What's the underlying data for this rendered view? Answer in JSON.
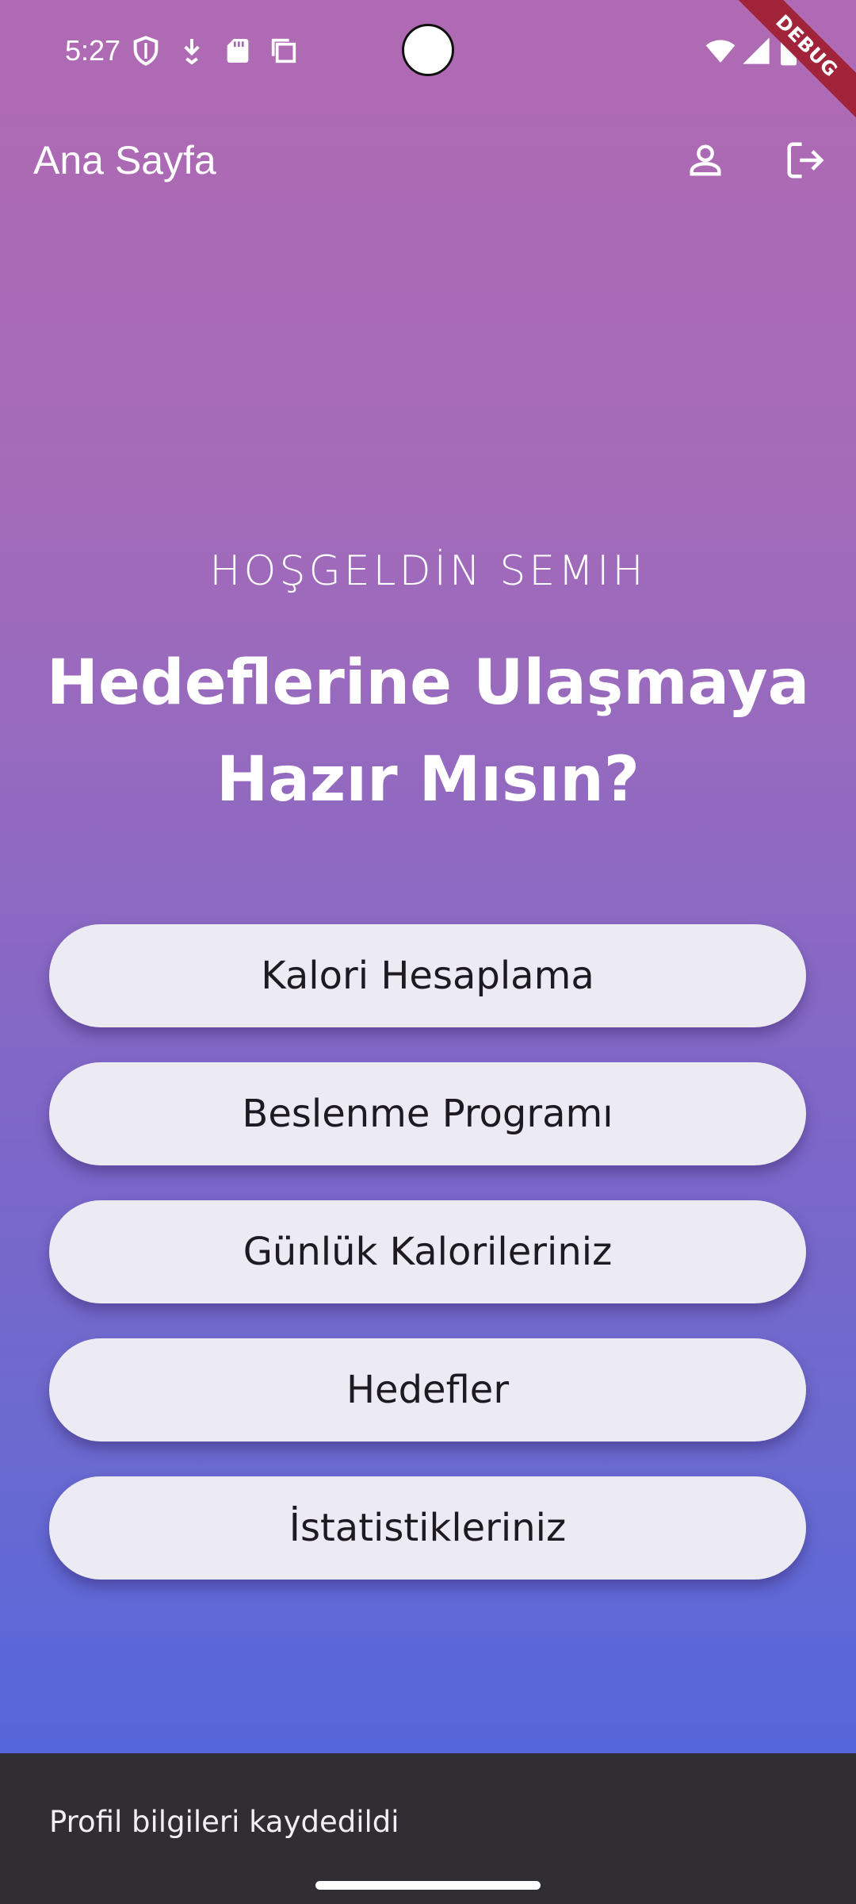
{
  "status_bar": {
    "time": "5:27",
    "left_icons": [
      "shield-icon",
      "download-icon",
      "sd-card-icon",
      "copy-icon"
    ],
    "right_icons": [
      "wifi-icon",
      "signal-icon",
      "battery-icon"
    ]
  },
  "debug_banner": "DEBUG",
  "app_bar": {
    "title": "Ana Sayfa",
    "actions": [
      "profile-icon",
      "logout-icon"
    ]
  },
  "hero": {
    "welcome": "HOŞGELDİN SEMIH",
    "headline": "Hedeflerine Ulaşmaya Hazır Mısın?"
  },
  "menu": {
    "items": [
      {
        "label": "Kalori Hesaplama"
      },
      {
        "label": "Beslenme Programı"
      },
      {
        "label": "Günlük Kalorileriniz"
      },
      {
        "label": "Hedefler"
      },
      {
        "label": "İstatistikleriniz"
      }
    ]
  },
  "snackbar": {
    "message": "Profil bilgileri kaydedildi"
  },
  "colors": {
    "gradient_top": "#b06ab3",
    "gradient_bottom": "#4a64dd",
    "button_bg": "#eceaf3",
    "snackbar_bg": "#302e33",
    "debug_ribbon": "#a1243a"
  }
}
